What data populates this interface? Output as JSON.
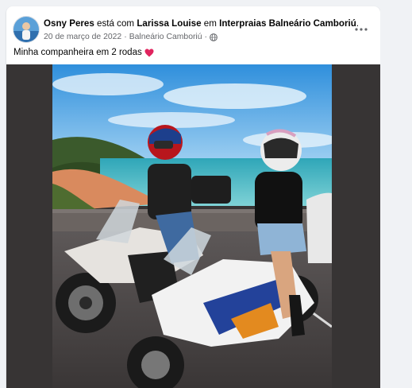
{
  "post": {
    "author": "Osny Peres",
    "with_text": "está com",
    "tagged_user": "Larissa Louise",
    "at_text": "em",
    "location": "Interpraias Balneário Camboriú",
    "location_suffix": ".",
    "date": "20 de março de 2022",
    "separator": "·",
    "place": "Balneário Camboriú",
    "separator2": "·",
    "privacy_icon": "globe-icon",
    "caption": "Minha companheira em 2 rodas",
    "caption_emoji": "red-heart-icon",
    "more_icon": "more-options-icon"
  },
  "colors": {
    "page_bg": "#f0f2f5",
    "card_bg": "#ffffff",
    "muted_text": "#65676b",
    "photo_frame": "#373434",
    "heart": "#e0245e"
  }
}
